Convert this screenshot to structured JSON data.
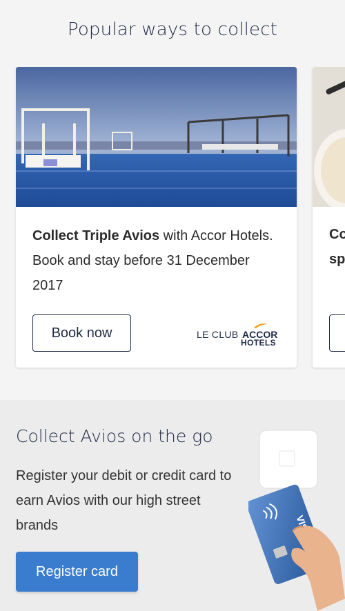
{
  "header": {
    "title": "Popular ways to collect"
  },
  "cards": [
    {
      "promo_bold": "Collect Triple Avios",
      "promo_rest": " with Accor Hotels. Book and stay before 31 December 2017",
      "button_label": "Book now",
      "partner_logo": {
        "line1_light": "LE CLUB",
        "line1_bold": "ACCOR",
        "line2": "HOTELS"
      }
    },
    {
      "promo_line1": "Co",
      "promo_line2": "sp"
    }
  ],
  "on_the_go": {
    "title": "Collect Avios on the go",
    "description": "Register your debit or credit card to earn Avios with our high street brands",
    "button_label": "Register card",
    "card_brand": "VISA"
  },
  "colors": {
    "accent_blue": "#3a7dcf",
    "navy": "#1f2a44",
    "accor_gold": "#f0a21b"
  }
}
